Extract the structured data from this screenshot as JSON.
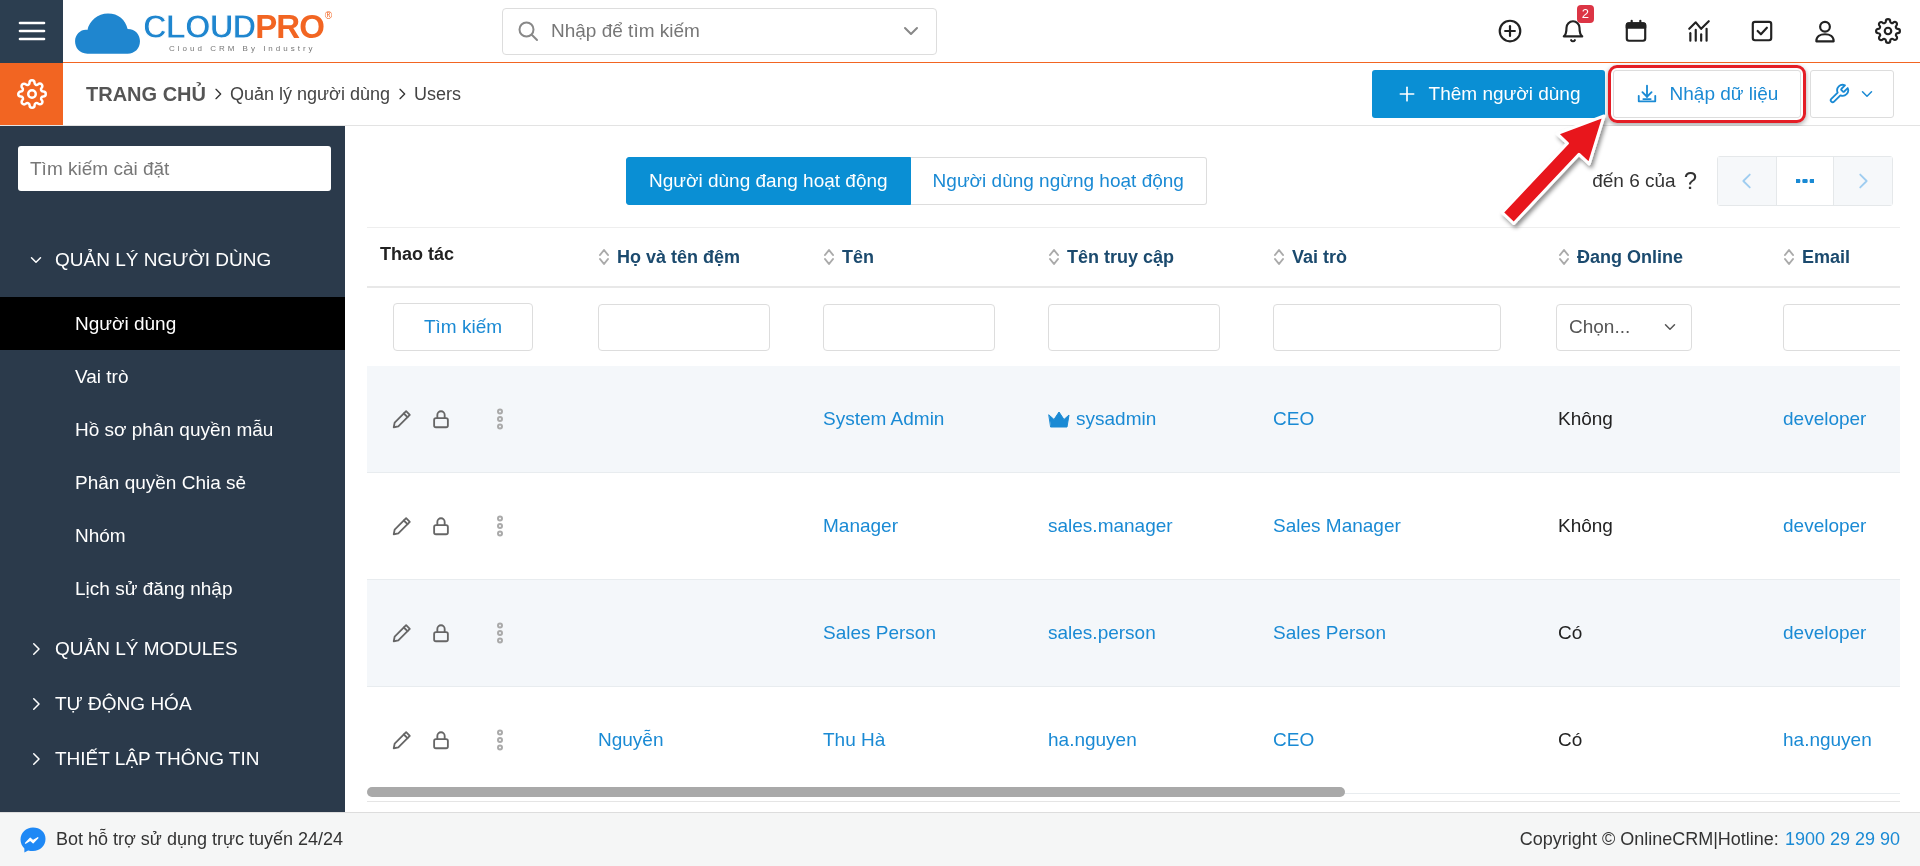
{
  "topbar": {
    "logo": {
      "brand_primary": "CLOUD",
      "brand_accent": "PRO",
      "registered": "®",
      "tagline": "Cloud CRM By Industry"
    },
    "search": {
      "placeholder": "Nhập để tìm kiếm"
    },
    "notification_count": "2"
  },
  "breadcrumb": [
    "TRANG CHỦ",
    "Quản lý người dùng",
    "Users"
  ],
  "actions": [
    {
      "kind": "add",
      "label": "Thêm người dùng",
      "highlighted": false
    },
    {
      "kind": "import",
      "label": "Nhập dữ liệu",
      "highlighted": true
    },
    {
      "kind": "tools",
      "highlighted": false
    }
  ],
  "sidebar": {
    "search": {
      "placeholder": "Tìm kiếm cài đặt"
    },
    "sections": [
      {
        "label": "QUẢN LÝ NGƯỜI DÙNG",
        "expanded": true,
        "children": [
          {
            "label": "Người dùng",
            "selected": true
          },
          {
            "label": "Vai trò",
            "selected": false
          },
          {
            "label": "Hồ sơ phân quyền mẫu",
            "selected": false
          },
          {
            "label": "Phân quyền Chia sẻ",
            "selected": false
          },
          {
            "label": "Nhóm",
            "selected": false
          },
          {
            "label": "Lịch sử đăng nhập",
            "selected": false
          }
        ]
      },
      {
        "label": "QUẢN LÝ MODULES",
        "expanded": false
      },
      {
        "label": "TỰ ĐỘNG HÓA",
        "expanded": false
      },
      {
        "label": "THIẾT LẬP THÔNG TIN",
        "expanded": false
      }
    ]
  },
  "tabs": [
    {
      "label": "Người dùng đang hoạt động",
      "selected": true
    },
    {
      "label": "Người dùng ngừng hoạt động",
      "selected": false
    }
  ],
  "pagination": {
    "range_text": "đến 6 của",
    "total": "?"
  },
  "table": {
    "columns": [
      {
        "label": "Thao tác",
        "sortable": false
      },
      {
        "label": "Họ và tên đệm",
        "sortable": true
      },
      {
        "label": "Tên",
        "sortable": true
      },
      {
        "label": "Tên truy cập",
        "sortable": true
      },
      {
        "label": "Vai trò",
        "sortable": true
      },
      {
        "label": "Đang Online",
        "sortable": true
      },
      {
        "label": "Email",
        "sortable": true
      }
    ],
    "filters": [
      {
        "kind": "button",
        "label": "Tìm kiếm"
      },
      {
        "kind": "text"
      },
      {
        "kind": "text"
      },
      {
        "kind": "text"
      },
      {
        "kind": "text"
      },
      {
        "kind": "select",
        "placeholder": "Chọn..."
      },
      {
        "kind": "text"
      }
    ],
    "rows": [
      {
        "name": "System Admin",
        "username": "sysadmin",
        "admin": true,
        "role": "CEO",
        "online": "Không",
        "email": "developer"
      },
      {
        "name": "Manager",
        "username": "sales.manager",
        "admin": false,
        "role": "Sales Manager",
        "online": "Không",
        "email": "developer"
      },
      {
        "name": "Sales Person",
        "username": "sales.person",
        "admin": false,
        "role": "Sales Person",
        "online": "Có",
        "email": "developer"
      },
      {
        "first_middle": "Nguyễn",
        "name": "Thu Hà",
        "username": "ha.nguyen",
        "admin": false,
        "role": "CEO",
        "online": "Có",
        "email": "ha.nguyen"
      }
    ]
  },
  "footer": {
    "bot_text": "Bot hỗ trợ sử dụng trực tuyến 24/24",
    "copyright": "Copyright © OnlineCRM|Hotline:",
    "hotline": "1900 29 29 90"
  }
}
